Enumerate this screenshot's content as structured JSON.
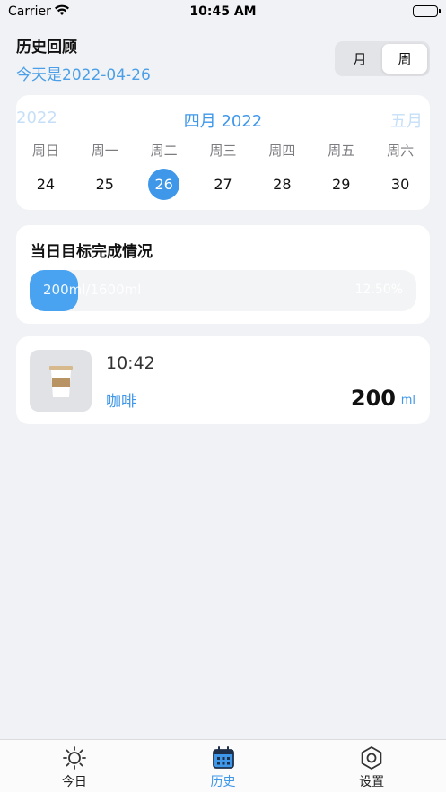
{
  "status_bar": {
    "carrier": "Carrier",
    "time": "10:45 AM"
  },
  "header": {
    "title": "历史回顾",
    "subtitle": "今天是2022-04-26"
  },
  "segmented": {
    "month_label": "月",
    "week_label": "周",
    "selected": "周"
  },
  "calendar": {
    "prev_label": "2022",
    "current_label": "四月 2022",
    "next_label": "五月",
    "weekdays": [
      "周日",
      "周一",
      "周二",
      "周三",
      "周四",
      "周五",
      "周六"
    ],
    "dates": [
      "24",
      "25",
      "26",
      "27",
      "28",
      "29",
      "30"
    ],
    "selected_date": "26",
    "accent_color": "#3f97ea"
  },
  "goal": {
    "title": "当日目标完成情况",
    "progress_text": "200ml/1600ml",
    "percent_text": "12.50%",
    "progress_fraction": 0.125
  },
  "records": [
    {
      "time": "10:42",
      "name": "咖啡",
      "amount": "200",
      "unit": "ml",
      "icon": "coffee-cup-icon"
    }
  ],
  "tabbar": {
    "items": [
      {
        "label": "今日",
        "icon": "sun-icon",
        "active": false
      },
      {
        "label": "历史",
        "icon": "calendar-icon",
        "active": true
      },
      {
        "label": "设置",
        "icon": "settings-hexagon-icon",
        "active": false
      }
    ],
    "active_color": "#3f97ea"
  }
}
